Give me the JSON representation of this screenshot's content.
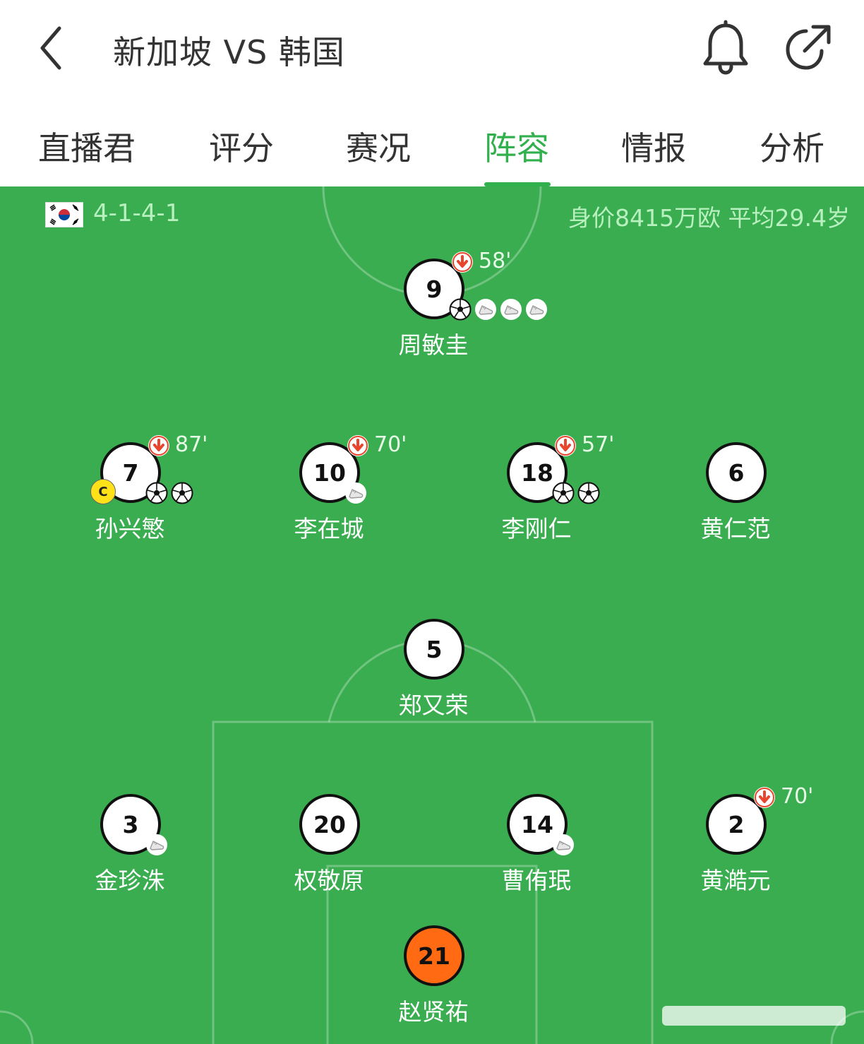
{
  "header": {
    "title": "新加坡 VS 韩国",
    "back_icon": "chevron-left-icon",
    "bell_icon": "bell-icon",
    "share_icon": "share-icon"
  },
  "tabs": [
    {
      "label": "直播君"
    },
    {
      "label": "评分"
    },
    {
      "label": "赛况"
    },
    {
      "label": "阵容",
      "active": true
    },
    {
      "label": "情报"
    },
    {
      "label": "分析"
    }
  ],
  "team": {
    "flag": "korea-flag-icon",
    "formation": "4-1-4-1",
    "info": "身价8415万欧 平均29.4岁"
  },
  "colors": {
    "accent": "#33b04e",
    "pitch": "#39ad4f",
    "goalkeeper": "#ff6a13",
    "captain": "#ffe11a",
    "sub_arrow": "#e8452c"
  },
  "players": [
    {
      "number": "9",
      "name": "周敏圭",
      "sub_time": "58'",
      "events": [
        "goal",
        "assist",
        "assist",
        "assist"
      ]
    },
    {
      "number": "7",
      "name": "孙兴慜",
      "sub_time": "87'",
      "captain": "C",
      "events": [
        "goal",
        "goal"
      ]
    },
    {
      "number": "10",
      "name": "李在城",
      "sub_time": "70'",
      "events": [
        "assist"
      ]
    },
    {
      "number": "18",
      "name": "李刚仁",
      "sub_time": "57'",
      "events": [
        "goal",
        "goal"
      ]
    },
    {
      "number": "6",
      "name": "黄仁范",
      "sub_time": "",
      "events": []
    },
    {
      "number": "5",
      "name": "郑又荣",
      "sub_time": "",
      "events": []
    },
    {
      "number": "3",
      "name": "金珍洙",
      "sub_time": "",
      "events": [
        "assist"
      ]
    },
    {
      "number": "20",
      "name": "权敬原",
      "sub_time": "",
      "events": []
    },
    {
      "number": "14",
      "name": "曹侑珉",
      "sub_time": "",
      "events": [
        "assist"
      ]
    },
    {
      "number": "2",
      "name": "黄澔元",
      "sub_time": "70'",
      "events": []
    },
    {
      "number": "21",
      "name": "赵贤祐",
      "sub_time": "",
      "goalkeeper": true,
      "events": []
    }
  ]
}
